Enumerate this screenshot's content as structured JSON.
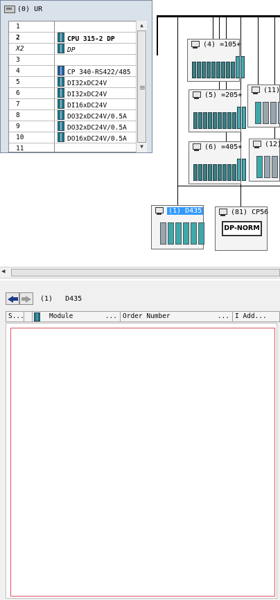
{
  "rack": {
    "title": "(0) UR",
    "rows": [
      {
        "slot": "1",
        "module": ""
      },
      {
        "slot": "2",
        "module": "CPU 315-2 DP"
      },
      {
        "slot": "X2",
        "module": "DP"
      },
      {
        "slot": "3",
        "module": ""
      },
      {
        "slot": "4",
        "module": "CP 340-RS422/485"
      },
      {
        "slot": "5",
        "module": "DI32xDC24V"
      },
      {
        "slot": "6",
        "module": "DI32xDC24V"
      },
      {
        "slot": "7",
        "module": "DI16xDC24V"
      },
      {
        "slot": "8",
        "module": "DO32xDC24V/0.5A"
      },
      {
        "slot": "9",
        "module": "DO32xDC24V/0.5A"
      },
      {
        "slot": "10",
        "module": "DO16xDC24V/0.5A"
      },
      {
        "slot": "11",
        "module": ""
      }
    ]
  },
  "network": {
    "devices": [
      {
        "label": "(4) =105+"
      },
      {
        "label": "(5) =205+"
      },
      {
        "label": "(6) =405+"
      },
      {
        "label": "(11)"
      },
      {
        "label": "(12)"
      },
      {
        "label": "(1) D435"
      },
      {
        "label": "(81) CP56",
        "body": "DP-NORM"
      }
    ]
  },
  "detail": {
    "path_index": "(1)",
    "path_name": "D435",
    "columns": [
      {
        "label": "S..."
      },
      {
        "label": "Module",
        "more": "..."
      },
      {
        "label": "Order Number",
        "more": "..."
      },
      {
        "label": "I Add..."
      }
    ]
  }
}
